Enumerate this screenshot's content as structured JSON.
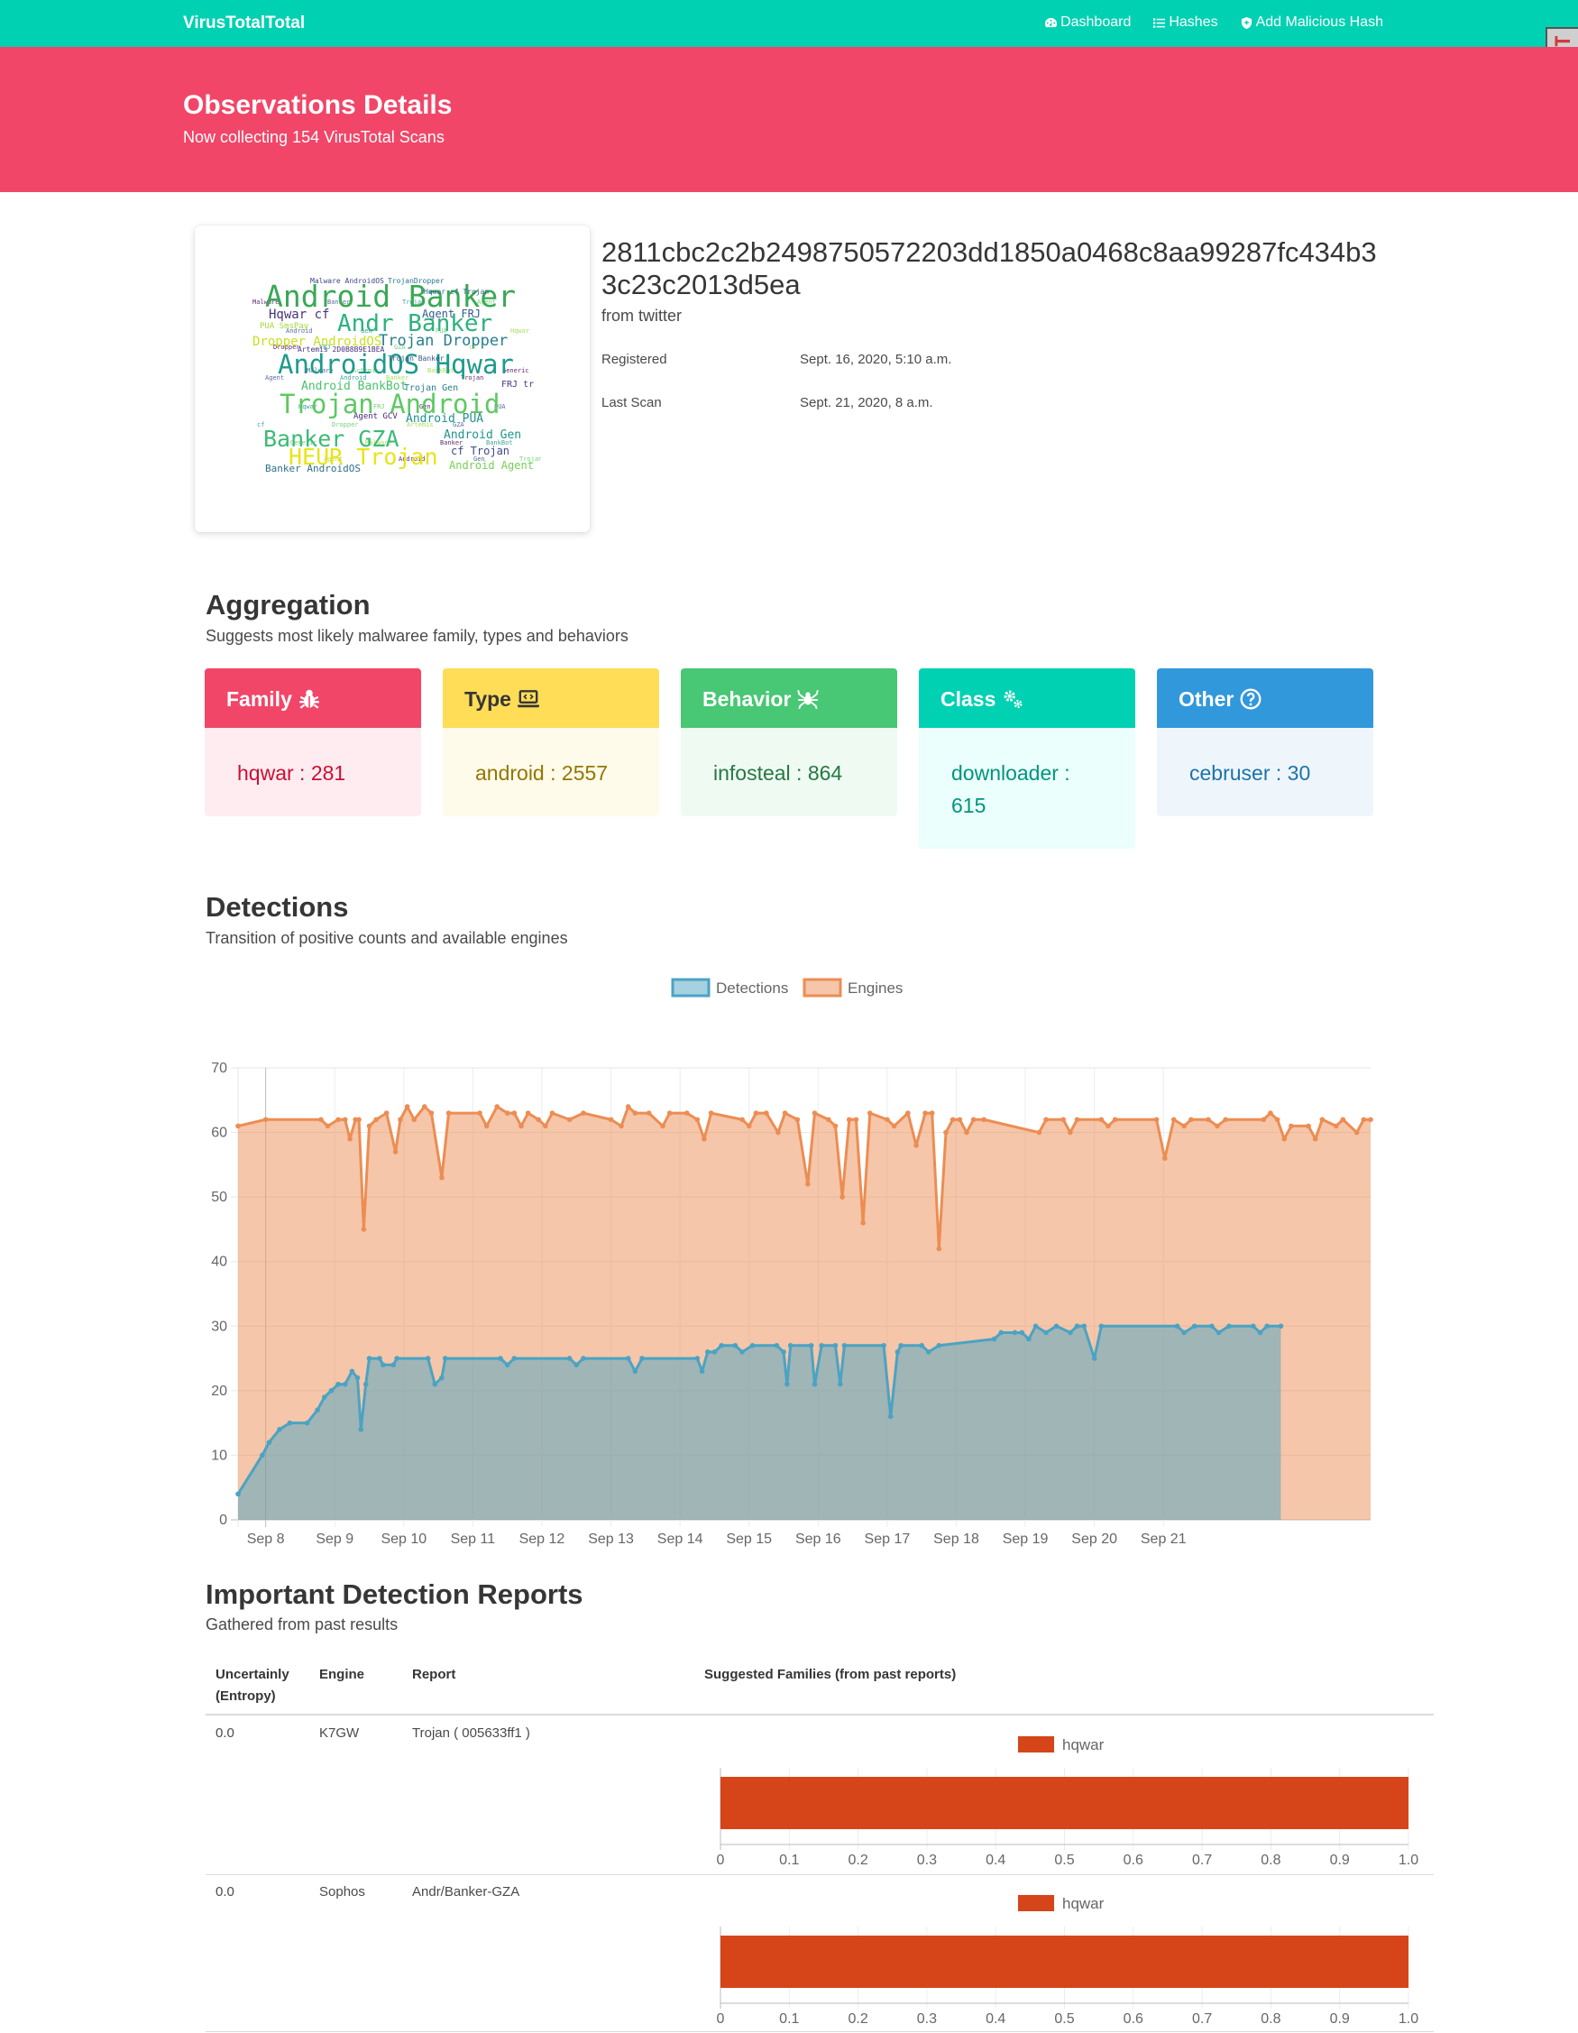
{
  "navbar": {
    "brand": "VirusTotalTotal",
    "links": [
      {
        "label": "Dashboard",
        "icon": "dashboard-icon"
      },
      {
        "label": "Hashes",
        "icon": "list-icon"
      },
      {
        "label": "Add Malicious Hash",
        "icon": "shield-icon"
      }
    ],
    "badge": "DjDT"
  },
  "hero": {
    "title": "Observations Details",
    "subtitle": "Now collecting 154 VirusTotal Scans"
  },
  "observation": {
    "hash": "2811cbc2c2b2498750572203dd1850a0468c8aa99287fc434b33c23c2013d5ea",
    "source": "from twitter",
    "registered_label": "Registered",
    "registered_value": "Sept. 16, 2020, 5:10 a.m.",
    "last_scan_label": "Last Scan",
    "last_scan_value": "Sept. 21, 2020, 8 a.m.",
    "wordcloud": {
      "words": [
        "Android Banker",
        "Hqwar cf",
        "Andr Banker",
        "Agent FRJ",
        "Dropper AndroidOS",
        "Trojan Dropper",
        "AndroidOS Hqwar",
        "Android BankBot",
        "Trojan Gen",
        "FRJ tr",
        "Trojan Android",
        "Android PUA",
        "Agent GCV",
        "Banker GZA",
        "Android Gen",
        "HEUR Trojan",
        "cf Trojan",
        "Banker AndroidOS",
        "Android Agent",
        "PUA SmsPay",
        "Artemis 2D0B8B9E1BEA",
        "Gen Android",
        "Trojan Banker",
        "Malware AndroidOS",
        "Hqwar cf Trojan",
        "TrojanDropper"
      ]
    }
  },
  "aggregation": {
    "title": "Aggregation",
    "subtitle": "Suggests most likely malwaree family, types and behaviors",
    "cards": [
      {
        "label": "Family",
        "value": "hqwar : 281",
        "icon": "bug-icon",
        "head_color": "#f14668",
        "body_bg": "#feecf0",
        "text_color": "#cc0f35"
      },
      {
        "label": "Type",
        "value": "android : 2557",
        "icon": "laptop-code-icon",
        "head_color": "#ffdd57",
        "body_bg": "#fffbeb",
        "text_color": "#947600"
      },
      {
        "label": "Behavior",
        "value": "infosteal : 864",
        "icon": "spider-icon",
        "head_color": "#48c774",
        "body_bg": "#effaf3",
        "text_color": "#257942"
      },
      {
        "label": "Class",
        "value": "downloader : 615",
        "icon": "cogs-icon",
        "head_color": "#00d1b2",
        "body_bg": "#ebfffc",
        "text_color": "#00947e"
      },
      {
        "label": "Other",
        "value": "cebruser : 30",
        "icon": "question-circle-icon",
        "head_color": "#3298dc",
        "body_bg": "#eef6fc",
        "text_color": "#1d72aa"
      }
    ]
  },
  "detections": {
    "title": "Detections",
    "subtitle": "Transition of positive counts and available engines"
  },
  "chart_data": [
    {
      "type": "area",
      "title": "",
      "xlabel": "",
      "ylabel": "",
      "x_ticks": [
        "Sep 8",
        "Sep 9",
        "Sep 10",
        "Sep 11",
        "Sep 12",
        "Sep 13",
        "Sep 14",
        "Sep 15",
        "Sep 16",
        "Sep 17",
        "Sep 18",
        "Sep 19",
        "Sep 20",
        "Sep 21"
      ],
      "ylim": [
        0,
        70
      ],
      "y_ticks": [
        0,
        10,
        20,
        30,
        40,
        50,
        60,
        70
      ],
      "grid": true,
      "legend": "top-center",
      "series": [
        {
          "name": "Detections",
          "color": "#4ba3c3",
          "fill": "rgba(75,163,195,0.5)",
          "points": [
            [
              7.6,
              4
            ],
            [
              7.95,
              10
            ],
            [
              8.05,
              12
            ],
            [
              8.2,
              14
            ],
            [
              8.35,
              15
            ],
            [
              8.6,
              15
            ],
            [
              8.75,
              17
            ],
            [
              8.85,
              19
            ],
            [
              8.95,
              20
            ],
            [
              9.05,
              21
            ],
            [
              9.15,
              21
            ],
            [
              9.25,
              23
            ],
            [
              9.33,
              22
            ],
            [
              9.38,
              14
            ],
            [
              9.45,
              21
            ],
            [
              9.5,
              25
            ],
            [
              9.65,
              25
            ],
            [
              9.7,
              24
            ],
            [
              9.85,
              24
            ],
            [
              9.9,
              25
            ],
            [
              10.35,
              25
            ],
            [
              10.45,
              21
            ],
            [
              10.55,
              22
            ],
            [
              10.6,
              25
            ],
            [
              11.4,
              25
            ],
            [
              11.5,
              24
            ],
            [
              11.6,
              25
            ],
            [
              12.4,
              25
            ],
            [
              12.5,
              24
            ],
            [
              12.6,
              25
            ],
            [
              13.25,
              25
            ],
            [
              13.35,
              23
            ],
            [
              13.45,
              25
            ],
            [
              14.25,
              25
            ],
            [
              14.32,
              23
            ],
            [
              14.4,
              26
            ],
            [
              14.5,
              26
            ],
            [
              14.6,
              27
            ],
            [
              14.8,
              27
            ],
            [
              14.9,
              26
            ],
            [
              15.05,
              27
            ],
            [
              15.4,
              27
            ],
            [
              15.5,
              26
            ],
            [
              15.55,
              21
            ],
            [
              15.6,
              27
            ],
            [
              15.9,
              27
            ],
            [
              15.95,
              21
            ],
            [
              16.05,
              27
            ],
            [
              16.25,
              27
            ],
            [
              16.32,
              21
            ],
            [
              16.38,
              27
            ],
            [
              16.95,
              27
            ],
            [
              17.05,
              16
            ],
            [
              17.15,
              26
            ],
            [
              17.2,
              27
            ],
            [
              17.5,
              27
            ],
            [
              17.6,
              26
            ],
            [
              17.75,
              27
            ],
            [
              18.55,
              28
            ],
            [
              18.65,
              29
            ],
            [
              18.85,
              29
            ],
            [
              18.95,
              29
            ],
            [
              19.05,
              28
            ],
            [
              19.15,
              30
            ],
            [
              19.3,
              29
            ],
            [
              19.45,
              30
            ],
            [
              19.65,
              29
            ],
            [
              19.75,
              30
            ],
            [
              19.85,
              30
            ],
            [
              20.0,
              25
            ],
            [
              20.1,
              30
            ],
            [
              21.2,
              30
            ],
            [
              21.3,
              29
            ],
            [
              21.45,
              30
            ],
            [
              21.7,
              30
            ],
            [
              21.8,
              29
            ],
            [
              21.95,
              30
            ],
            [
              22.3,
              30
            ],
            [
              22.4,
              29
            ],
            [
              22.5,
              30
            ],
            [
              22.7,
              30
            ]
          ]
        },
        {
          "name": "Engines",
          "color": "#ec8d53",
          "fill": "rgba(236,141,83,0.5)",
          "points": [
            [
              7.6,
              61
            ],
            [
              8.0,
              62
            ],
            [
              8.8,
              62
            ],
            [
              8.9,
              61
            ],
            [
              9.05,
              62
            ],
            [
              9.15,
              62
            ],
            [
              9.22,
              59
            ],
            [
              9.3,
              62
            ],
            [
              9.35,
              62
            ],
            [
              9.42,
              45
            ],
            [
              9.5,
              61
            ],
            [
              9.6,
              62
            ],
            [
              9.75,
              63
            ],
            [
              9.88,
              57
            ],
            [
              9.95,
              62
            ],
            [
              10.05,
              64
            ],
            [
              10.15,
              62
            ],
            [
              10.3,
              64
            ],
            [
              10.4,
              63
            ],
            [
              10.55,
              53
            ],
            [
              10.65,
              63
            ],
            [
              11.1,
              63
            ],
            [
              11.2,
              61
            ],
            [
              11.35,
              64
            ],
            [
              11.5,
              63
            ],
            [
              11.6,
              63
            ],
            [
              11.7,
              61
            ],
            [
              11.8,
              63
            ],
            [
              11.95,
              62
            ],
            [
              12.05,
              61
            ],
            [
              12.15,
              63
            ],
            [
              12.4,
              62
            ],
            [
              12.6,
              63
            ],
            [
              13.0,
              62
            ],
            [
              13.15,
              61
            ],
            [
              13.25,
              64
            ],
            [
              13.35,
              63
            ],
            [
              13.55,
              63
            ],
            [
              13.75,
              61
            ],
            [
              13.85,
              63
            ],
            [
              14.1,
              63
            ],
            [
              14.25,
              62
            ],
            [
              14.35,
              59
            ],
            [
              14.45,
              63
            ],
            [
              14.9,
              62
            ],
            [
              15.0,
              61
            ],
            [
              15.1,
              63
            ],
            [
              15.25,
              63
            ],
            [
              15.42,
              60
            ],
            [
              15.52,
              63
            ],
            [
              15.7,
              62
            ],
            [
              15.85,
              52
            ],
            [
              15.95,
              63
            ],
            [
              16.15,
              62
            ],
            [
              16.25,
              61
            ],
            [
              16.35,
              50
            ],
            [
              16.45,
              62
            ],
            [
              16.55,
              62
            ],
            [
              16.65,
              46
            ],
            [
              16.75,
              63
            ],
            [
              17.0,
              62
            ],
            [
              17.1,
              61
            ],
            [
              17.3,
              63
            ],
            [
              17.42,
              58
            ],
            [
              17.55,
              63
            ],
            [
              17.65,
              63
            ],
            [
              17.75,
              42
            ],
            [
              17.85,
              60
            ],
            [
              17.95,
              62
            ],
            [
              18.05,
              62
            ],
            [
              18.15,
              60
            ],
            [
              18.25,
              62
            ],
            [
              18.4,
              62
            ],
            [
              19.2,
              60
            ],
            [
              19.3,
              62
            ],
            [
              19.55,
              62
            ],
            [
              19.65,
              60
            ],
            [
              19.75,
              62
            ],
            [
              20.1,
              62
            ],
            [
              20.2,
              61
            ],
            [
              20.3,
              62
            ],
            [
              20.9,
              62
            ],
            [
              21.02,
              56
            ],
            [
              21.15,
              62
            ],
            [
              21.3,
              61
            ],
            [
              21.4,
              62
            ],
            [
              21.65,
              62
            ],
            [
              21.78,
              61
            ],
            [
              21.9,
              62
            ],
            [
              22.45,
              62
            ],
            [
              22.55,
              63
            ],
            [
              22.65,
              62
            ],
            [
              22.75,
              59
            ],
            [
              22.85,
              61
            ],
            [
              23.1,
              61
            ],
            [
              23.2,
              59
            ],
            [
              23.3,
              62
            ],
            [
              23.5,
              61
            ],
            [
              23.6,
              62
            ],
            [
              23.8,
              60
            ],
            [
              23.9,
              62
            ],
            [
              24.0,
              62
            ]
          ]
        }
      ]
    },
    {
      "type": "bar",
      "orientation": "horizontal",
      "categories": [
        "hqwar"
      ],
      "series": [
        {
          "name": "hqwar",
          "values": [
            1.0
          ]
        }
      ],
      "xlim": [
        0,
        1.0
      ],
      "x_ticks": [
        "0",
        "0.1",
        "0.2",
        "0.3",
        "0.4",
        "0.5",
        "0.6",
        "0.7",
        "0.8",
        "0.9",
        "1.0"
      ],
      "legend": "top-center",
      "color": "#d64519"
    },
    {
      "type": "bar",
      "orientation": "horizontal",
      "categories": [
        "hqwar"
      ],
      "series": [
        {
          "name": "hqwar",
          "values": [
            1.0
          ]
        }
      ],
      "xlim": [
        0,
        1.0
      ],
      "x_ticks": [
        "0",
        "0.1",
        "0.2",
        "0.3",
        "0.4",
        "0.5",
        "0.6",
        "0.7",
        "0.8",
        "0.9",
        "1.0"
      ],
      "legend": "top-center",
      "color": "#d64519"
    }
  ],
  "reports": {
    "title": "Important Detection Reports",
    "subtitle": "Gathered from past results",
    "columns": [
      "Uncertainly (Entropy)",
      "Engine",
      "Report",
      "Suggested Families (from past reports)"
    ],
    "rows": [
      {
        "entropy": "0.0",
        "engine": "K7GW",
        "report": "Trojan ( 005633ff1 )"
      },
      {
        "entropy": "0.0",
        "engine": "Sophos",
        "report": "Andr/Banker-GZA"
      }
    ]
  }
}
